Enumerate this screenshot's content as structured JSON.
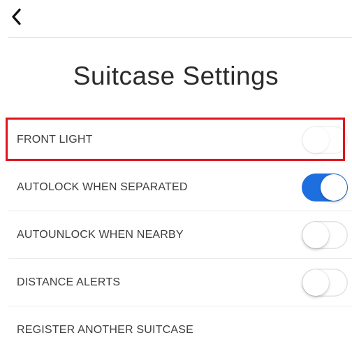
{
  "header": {
    "title": "Suitcase Settings",
    "back_icon": "chevron-left-icon"
  },
  "settings": [
    {
      "label": "FRONT LIGHT",
      "type": "toggle",
      "on": false,
      "highlighted": true
    },
    {
      "label": "AUTOLOCK WHEN SEPARATED",
      "type": "toggle",
      "on": true
    },
    {
      "label": "AUTOUNLOCK WHEN NEARBY",
      "type": "toggle",
      "on": false
    },
    {
      "label": "DISTANCE ALERTS",
      "type": "toggle",
      "on": false
    },
    {
      "label": "REGISTER ANOTHER SUITCASE",
      "type": "link"
    }
  ],
  "colors": {
    "toggle_on": "#1d6fe0",
    "highlight_border": "#e0141e"
  }
}
